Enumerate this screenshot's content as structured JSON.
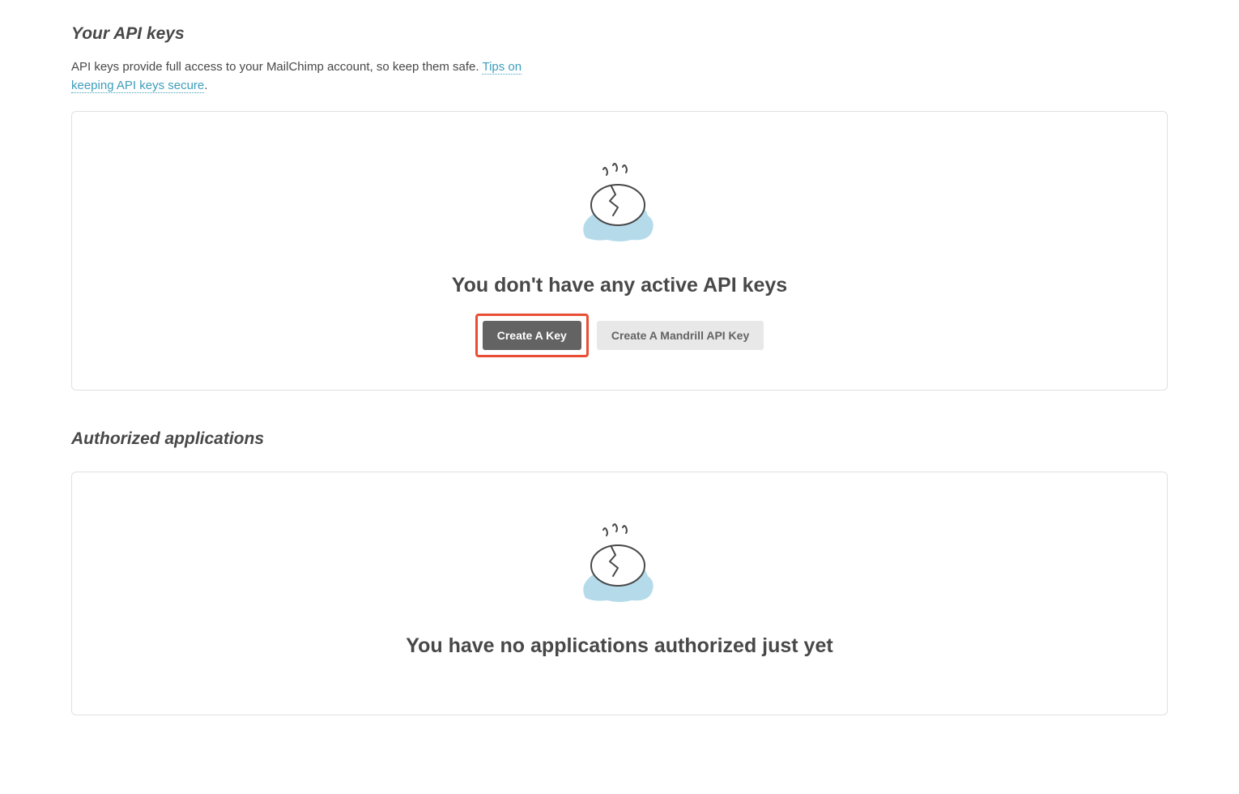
{
  "apiKeys": {
    "title": "Your API keys",
    "description_prefix": "API keys provide full access to your MailChimp account, so keep them safe. ",
    "description_link": "Tips on keeping API keys secure",
    "description_suffix": ".",
    "emptyMessage": "You don't have any active API keys",
    "createKeyLabel": "Create A Key",
    "createMandrillKeyLabel": "Create A Mandrill API Key"
  },
  "authorizedApps": {
    "title": "Authorized applications",
    "emptyMessage": "You have no applications authorized just yet"
  }
}
